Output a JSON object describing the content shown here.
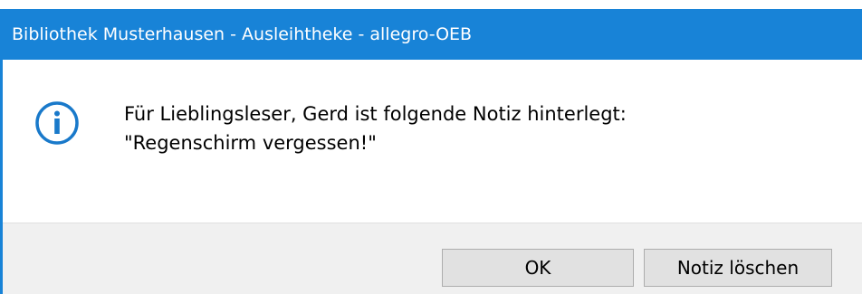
{
  "window": {
    "title": "Bibliothek Musterhausen - Ausleihtheke - allegro-OEB"
  },
  "message": {
    "icon": "info-icon",
    "line1": "Für Lieblingsleser, Gerd ist folgende Notiz hinterlegt:",
    "line2": "\"Regenschirm vergessen!\""
  },
  "buttons": {
    "ok_label": "OK",
    "delete_label": "Notiz löschen"
  },
  "colors": {
    "titlebar": "#1883d7",
    "icon": "#1979ca",
    "button_bar": "#f0f0f0",
    "button_face": "#e1e1e1"
  }
}
